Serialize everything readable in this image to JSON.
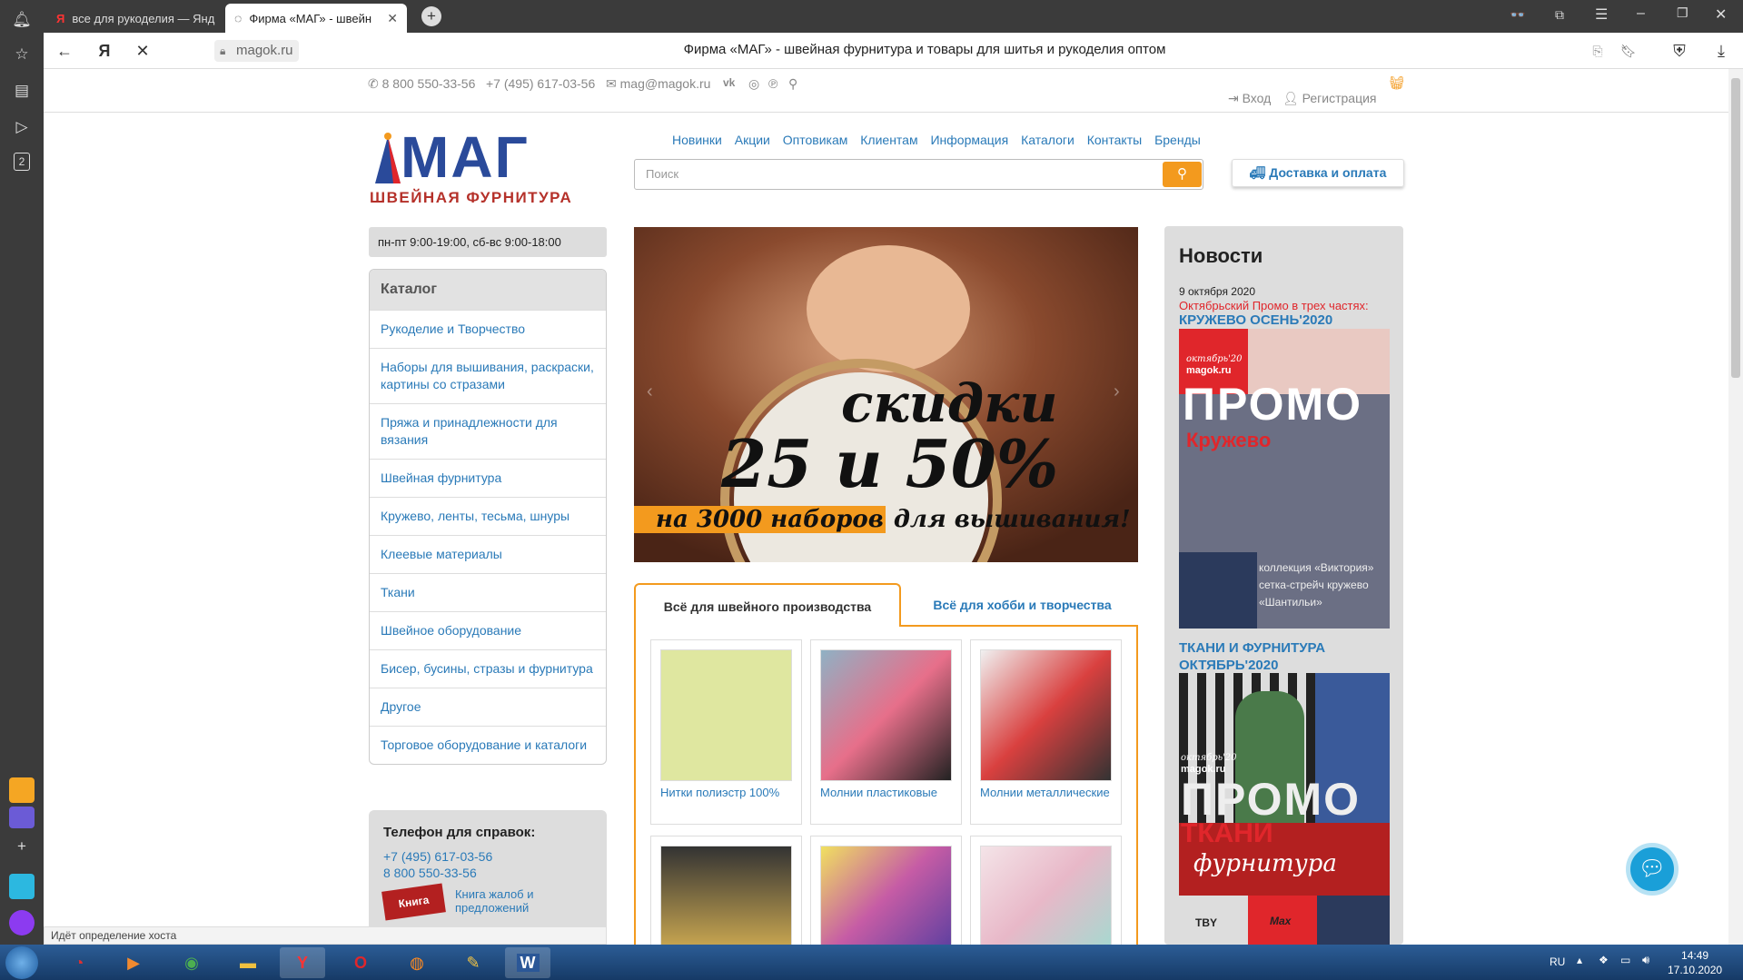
{
  "browser": {
    "tabs": [
      {
        "label": "все для рукоделия — Янд"
      },
      {
        "label": "Фирма «МАГ» - швейн"
      }
    ],
    "url": "magok.ru",
    "page_title": "Фирма «МАГ» - швейная фурнитура и товары для шитья и рукоделия оптом",
    "status": "Идёт определение хоста",
    "sidepanel_badge": "2"
  },
  "topbar": {
    "phone1": "8 800 550-33-56",
    "phone2": "+7 (495) 617-03-56",
    "email": "mag@magok.ru",
    "login": "Вход",
    "register": "Регистрация"
  },
  "logo": {
    "brand": "МАГ",
    "tagline": "ШВЕЙНАЯ ФУРНИТУРА"
  },
  "hours": "пн-пт 9:00-19:00, сб-вс 9:00-18:00",
  "nav": [
    "Новинки",
    "Акции",
    "Оптовикам",
    "Клиентам",
    "Информация",
    "Каталоги",
    "Контакты",
    "Бренды"
  ],
  "search": {
    "placeholder": "Поиск"
  },
  "delivery_button": "Доставка и оплата",
  "catalog": {
    "title": "Каталог",
    "items": [
      "Рукоделие и Творчество",
      "Наборы для вышивания, раскраски, картины со стразами",
      "Пряжа и принадлежности для вязания",
      "Швейная фурнитура",
      "Кружево, ленты, тесьма, шнуры",
      "Клеевые материалы",
      "Ткани",
      "Швейное оборудование",
      "Бисер, бусины, стразы и фурнитура",
      "Другое",
      "Торговое оборудование и каталоги"
    ]
  },
  "help": {
    "title": "Телефон для справок:",
    "phone1": "+7 (495) 617-03-56",
    "phone2": "8 800 550-33-56",
    "book_label": "Книга",
    "book_link": "Книга жалоб и предложений"
  },
  "banner": {
    "line1": "скидки",
    "line2": "25 и 50%",
    "line3_highlight": "на 3000 наборов",
    "line3_rest": " для вышивания!"
  },
  "product_tabs": {
    "active": "Всё для швейного производства",
    "other": "Всё для хобби и творчества"
  },
  "products": [
    {
      "label": "Нитки полиэстр 100%",
      "color": "#dfe7a0"
    },
    {
      "label": "Молнии пластиковые",
      "color": "#e76f8a"
    },
    {
      "label": "Молнии металлические",
      "color": "#d9403f"
    },
    {
      "label": "",
      "color": "#333333"
    },
    {
      "label": "",
      "color": "#c65ca5"
    },
    {
      "label": "",
      "color": "#e8b8c8"
    }
  ],
  "news": {
    "title": "Новости",
    "date": "9 октября 2020",
    "headline": "Октябрьский Промо в трех частях:",
    "item1_link": "КРУЖЕВО ОСЕНЬ'2020",
    "item1_image": {
      "month": "октябрь'20",
      "site": "magok.ru",
      "promo": "ПРОМО",
      "sub": "Кружево",
      "caption": "коллекция «Виктория» сетка-стрейч кружево «Шантильи»"
    },
    "item2_link": "ТКАНИ И ФУРНИТУРА ОКТЯБРЬ'2020",
    "item2_image": {
      "month": "октябрь'20",
      "site": "magok.ru",
      "promo": "ПРОМО",
      "sub1": "ТКАНИ",
      "sub2": "фурнитура",
      "brand1": "TBY",
      "brand2": "Max"
    }
  },
  "taskbar": {
    "lang": "RU",
    "time": "14:49",
    "date": "17.10.2020"
  },
  "colors": {
    "link": "#2a7ab8",
    "accent": "#f39a1e",
    "news_red": "#e0262b"
  }
}
